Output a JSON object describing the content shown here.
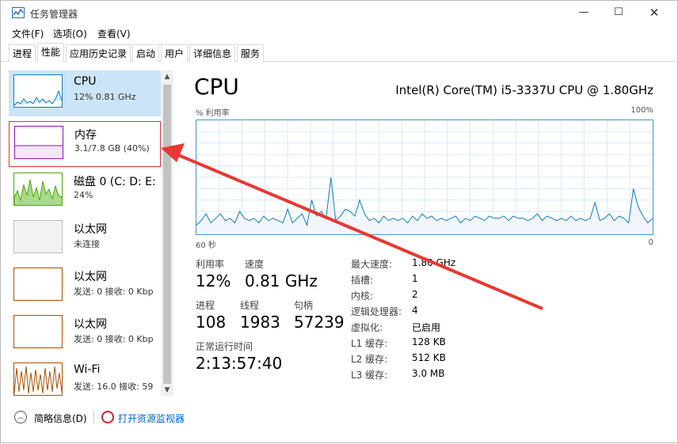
{
  "window": {
    "title": "任务管理器",
    "controls": {
      "minimize": "—",
      "maximize": "☐",
      "close": "✕"
    }
  },
  "menu": [
    "文件(F)",
    "选项(O)",
    "查看(V)"
  ],
  "tabs": [
    "进程",
    "性能",
    "应用历史记录",
    "启动",
    "用户",
    "详细信息",
    "服务"
  ],
  "active_tab": "性能",
  "sidebar": {
    "items": [
      {
        "name": "CPU",
        "sub": "12% 0.81 GHz",
        "color": "#117dbb"
      },
      {
        "name": "内存",
        "sub": "3.1/7.8 GB (40%)",
        "color": "#8b12ae"
      },
      {
        "name": "磁盘 0 (C: D: E:",
        "sub": "24%",
        "color": "#4da60c"
      },
      {
        "name": "以太网",
        "sub": "未连接",
        "color": "#a74f01"
      },
      {
        "name": "以太网",
        "sub": "发送: 0 接收: 0 Kbp",
        "color": "#a74f01"
      },
      {
        "name": "以太网",
        "sub": "发送: 0 接收: 0 Kbp",
        "color": "#a74f01"
      },
      {
        "name": "Wi-Fi",
        "sub": "发送: 16.0 接收: 59",
        "color": "#a74f01"
      }
    ]
  },
  "main": {
    "title": "CPU",
    "model": "Intel(R) Core(TM) i5-3337U CPU @ 1.80GHz",
    "graph_label_left": "% 利用率",
    "graph_label_right": "100%",
    "axis_left": "60 秒",
    "axis_right": "0",
    "stats": {
      "utilization_label": "利用率",
      "utilization": "12%",
      "speed_label": "速度",
      "speed": "0.81 GHz",
      "processes_label": "进程",
      "processes": "108",
      "threads_label": "线程",
      "threads": "1983",
      "handles_label": "句柄",
      "handles": "57239",
      "uptime_label": "正常运行时间",
      "uptime": "2:13:57:40"
    },
    "info": [
      {
        "label": "最大速度:",
        "value": "1.80 GHz"
      },
      {
        "label": "插槽:",
        "value": "1"
      },
      {
        "label": "内核:",
        "value": "2"
      },
      {
        "label": "逻辑处理器:",
        "value": "4"
      },
      {
        "label": "虚拟化:",
        "value": "已启用"
      },
      {
        "label": "L1 缓存:",
        "value": "128 KB"
      },
      {
        "label": "L2 缓存:",
        "value": "512 KB"
      },
      {
        "label": "L3 缓存:",
        "value": "3.0 MB"
      }
    ]
  },
  "footer": {
    "brief": "简略信息(D)",
    "monitor": "打开资源监视器"
  },
  "chart_data": {
    "type": "line",
    "series": [
      {
        "values": [
          8,
          12,
          18,
          10,
          14,
          18,
          12,
          14,
          10,
          20,
          14,
          12,
          14,
          10,
          16,
          12,
          14,
          12,
          10,
          22,
          10,
          14,
          18,
          8,
          30,
          16,
          20,
          14,
          50,
          12,
          16,
          22,
          20,
          16,
          30,
          18,
          12,
          14,
          10,
          16,
          12,
          14,
          12,
          14,
          10,
          16,
          12,
          18,
          14,
          16,
          12,
          14,
          12,
          14,
          16,
          10,
          14,
          12,
          16,
          14,
          12,
          16,
          14,
          14,
          16,
          12,
          16,
          14,
          14,
          12,
          14,
          18,
          12,
          16,
          14,
          12,
          14,
          12,
          16,
          12,
          14,
          12,
          14,
          28,
          12,
          14,
          18,
          12,
          16,
          14,
          10,
          40,
          24,
          16,
          10,
          14
        ]
      }
    ],
    "ylim": [
      0,
      100
    ],
    "grid": true
  }
}
